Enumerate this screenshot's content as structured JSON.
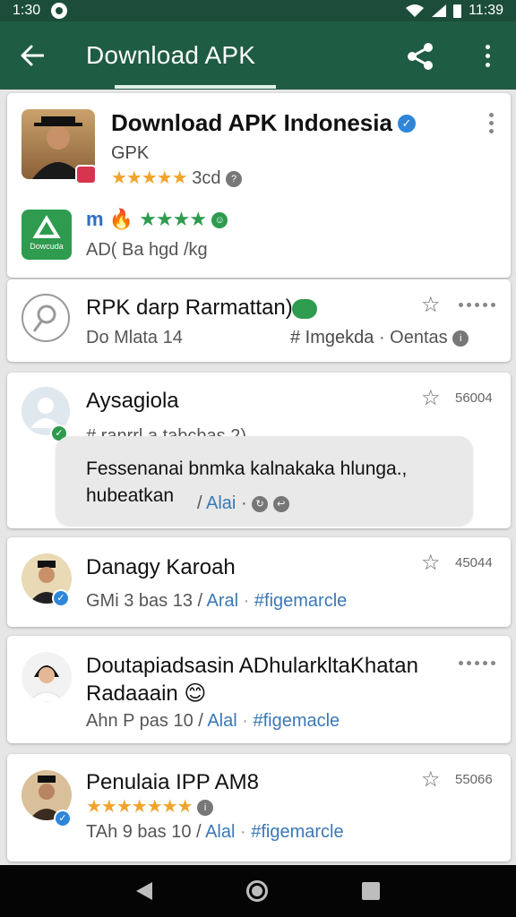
{
  "status_bar": {
    "time_left": "1:30",
    "time_right": "11:39"
  },
  "toolbar": {
    "title": "Download APK"
  },
  "header_card": {
    "title": "Download APK Indonesia",
    "subtitle": "GPK",
    "rating_stars": "★★★★★",
    "rating_text": "3cd",
    "app_rating_prefix": "m",
    "app_rating_stars": "★★★★",
    "app_icon_label": "Dowcuda",
    "app_line": "AD( Ba hgd /kg"
  },
  "rpk_card": {
    "title": "RPK darp Rarmattan)",
    "meta_left": "Do Mlata 14",
    "meta_tag": "# Imgekda",
    "meta_right": "Oentas"
  },
  "message_card": {
    "name": "Aysagiola",
    "count": "56004",
    "subtitle": "# ranrrl a tabcbas 2)",
    "bubble_text": "Fessenanai bnmka kalnakaka hlunga., hubeatkan",
    "bubble_link": "Alai"
  },
  "posts": [
    {
      "name": "Danagy Karoah",
      "count": "45044",
      "date": "GMi 3 bas 13",
      "link": "Aral",
      "tag": "#figemarcle"
    },
    {
      "name": "Doutapiadsasin ADhularkltaKhatan",
      "name2": "Radaaain",
      "emoji": "😊",
      "date": "Ahn P pas 10",
      "link": "Alal",
      "tag": "#figemacle"
    },
    {
      "name": "Penulaia IPP AM8",
      "count": "55066",
      "stars": "★★★★★★★",
      "date": "TAh 9 bas 10",
      "link": "Alal",
      "tag": "#figemarcle"
    }
  ],
  "colors": {
    "toolbar": "#1f5c44",
    "status_bar": "#1b4d3a",
    "accent_link": "#3a78b6",
    "star": "#f0a42b",
    "verified": "#2f86d9"
  }
}
